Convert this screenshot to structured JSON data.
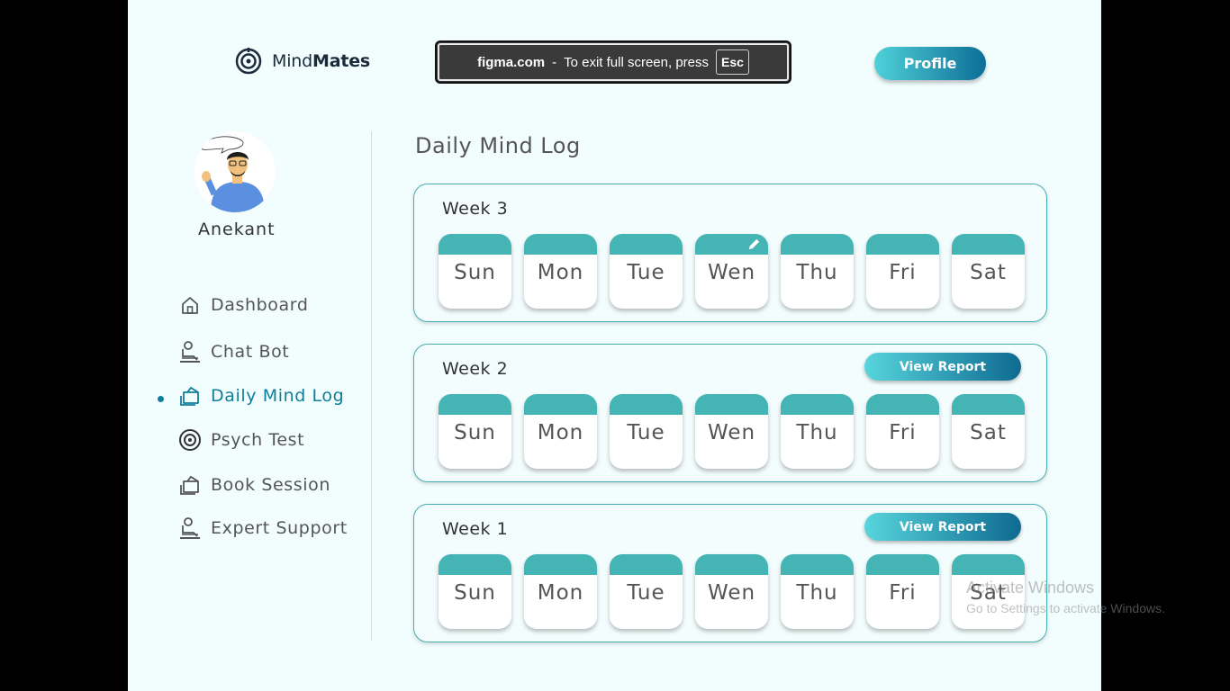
{
  "header": {
    "logo_word1": "Mind",
    "logo_word2": "Mates",
    "profile_label": "Profile"
  },
  "browser_banner": {
    "domain": "figma.com",
    "separator": "-",
    "message": "To exit full screen, press",
    "key": "Esc"
  },
  "sidebar": {
    "user_name": "Anekant",
    "items": [
      {
        "label": "Dashboard",
        "icon": "home-icon",
        "active": false
      },
      {
        "label": "Chat Bot",
        "icon": "chat-bot-icon",
        "active": false
      },
      {
        "label": "Daily Mind Log",
        "icon": "log-icon",
        "active": true
      },
      {
        "label": "Psych Test",
        "icon": "psych-test-icon",
        "active": false
      },
      {
        "label": "Book Session",
        "icon": "book-icon",
        "active": false
      },
      {
        "label": "Expert Support",
        "icon": "expert-icon",
        "active": false
      }
    ]
  },
  "main": {
    "title": "Daily Mind Log",
    "weeks": [
      {
        "title": "Week 3",
        "view_report": null,
        "days": [
          "Sun",
          "Mon",
          "Tue",
          "Wen",
          "Thu",
          "Fri",
          "Sat"
        ]
      },
      {
        "title": "Week 2",
        "view_report": "View Report",
        "days": [
          "Sun",
          "Mon",
          "Tue",
          "Wen",
          "Thu",
          "Fri",
          "Sat"
        ]
      },
      {
        "title": "Week 1",
        "view_report": "View Report",
        "days": [
          "Sun",
          "Mon",
          "Tue",
          "Wen",
          "Thu",
          "Fri",
          "Sat"
        ]
      }
    ]
  },
  "watermark": {
    "title": "Activate Windows",
    "subtitle": "Go to Settings to activate Windows."
  },
  "colors": {
    "accent": "#0f7e9c",
    "day_tab": "#45b4b5",
    "page_bg": "#f2fdfd"
  }
}
